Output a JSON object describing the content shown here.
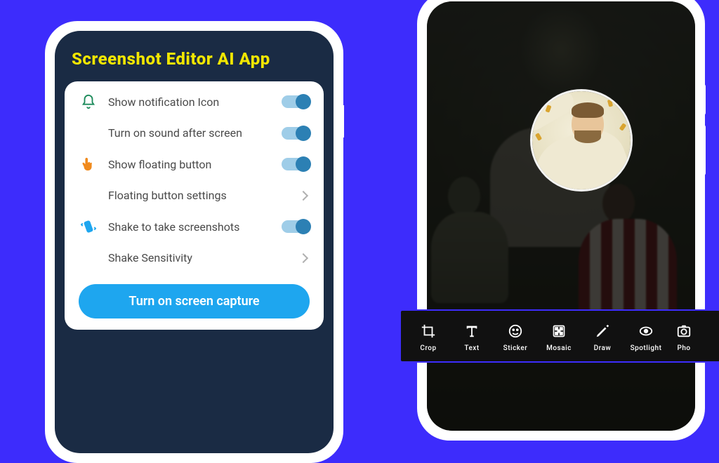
{
  "title": "Screenshot Editor AI App",
  "settings": {
    "items": [
      {
        "label": "Show notification Icon",
        "control": "switch",
        "icon": "bell"
      },
      {
        "label": "Turn on sound after screen",
        "control": "switch",
        "icon": null
      },
      {
        "label": "Show floating button",
        "control": "switch",
        "icon": "pointer"
      },
      {
        "label": "Floating button settings",
        "control": "chevron",
        "icon": null
      },
      {
        "label": "Shake to take screenshots",
        "control": "switch",
        "icon": "shake"
      },
      {
        "label": "Shake Sensitivity",
        "control": "chevron",
        "icon": null
      }
    ],
    "cta_label": "Turn on screen capture"
  },
  "toolbar": {
    "items": [
      {
        "label": "Crop",
        "icon": "crop"
      },
      {
        "label": "Text",
        "icon": "text"
      },
      {
        "label": "Sticker",
        "icon": "sticker"
      },
      {
        "label": "Mosaic",
        "icon": "mosaic"
      },
      {
        "label": "Draw",
        "icon": "draw"
      },
      {
        "label": "Spotlight",
        "icon": "spotlight"
      },
      {
        "label": "Pho",
        "icon": "photo"
      }
    ]
  }
}
